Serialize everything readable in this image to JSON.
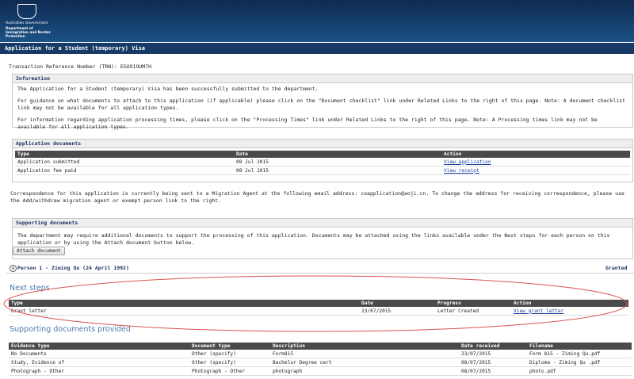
{
  "header": {
    "gov_line": "Australian Government",
    "dept_line": "Department of Immigration and Border Protection"
  },
  "title": "Application for a Student (temporary) Visa",
  "trn": "Transaction Reference Number (TRN): EGO919UM7H",
  "info": {
    "heading": "Information",
    "p1": "The Application for a Student (temporary) Visa has been successfully submitted to the department.",
    "p2": "For guidance on what documents to attach to this application (if applicable) please click on the \"Document checklist\" link under Related Links to the right of this page. Note: A document checklist link may not be available for all application types.",
    "p3": "For information regarding application processing times, please click on the \"Processing Times\" link under Related Links to the right of this page. Note: A Processing times link may not be available for all application types."
  },
  "app_docs": {
    "heading": "Application documents",
    "columns": [
      "Type",
      "Date",
      "Action"
    ],
    "rows": [
      {
        "type": "Application submitted",
        "date": "08 Jul 2015",
        "action": "View application"
      },
      {
        "type": "Application fee paid",
        "date": "08 Jul 2015",
        "action": "View receipt"
      }
    ]
  },
  "correspondence": "Correspondence for this application is currently being sent to a Migration Agent at the following email address: coapplication@aoji.cn. To change the address for receiving correspondence, please use the Add/withdraw migration agent or exempt person link to the right.",
  "supporting": {
    "heading": "Supporting documents",
    "text": "The department may require additional documents to support the processing of this application. Documents may be attached using the links available under the Next steps for each person on this application or by using the Attach document button below.",
    "attach_label": "Attach document"
  },
  "person": {
    "label": "Person 1 - Ziming Qu (24 April 1992)",
    "status": "Granted",
    "toggle_glyph": "⊖"
  },
  "next_steps": {
    "title": "Next steps",
    "columns": [
      "Type",
      "Date",
      "Progress",
      "Action"
    ],
    "rows": [
      {
        "type": "Grant letter",
        "date": "23/07/2015",
        "progress": "Letter Created",
        "action": "View grant letter"
      }
    ]
  },
  "provided": {
    "title": "Supporting documents provided",
    "columns": [
      "Evidence type",
      "Document type",
      "Description",
      "Date received",
      "Filename"
    ],
    "rows": [
      {
        "evidence": "No Documents",
        "doctype": "Other (specify)",
        "desc": "Form815",
        "date": "23/07/2015",
        "file": "Form 815 - Ziming Qu.pdf"
      },
      {
        "evidence": "Study, Evidence of",
        "doctype": "Other (specify)",
        "desc": "Bachelor Degree cert",
        "date": "08/07/2015",
        "file": "Diploma - Ziming Qu .pdf"
      },
      {
        "evidence": "Photograph - Other",
        "doctype": "Photograph - Other",
        "desc": "photograph",
        "date": "08/07/2015",
        "file": "photo.pdf"
      }
    ]
  },
  "colors": {
    "header_top": "#102a52",
    "header_bottom": "#1c5285",
    "titlebar": "#173a66",
    "table_header": "#4a4a4a",
    "section_title": "#4c78a8",
    "link": "#1a3fa0",
    "annotation": "#d9534f"
  }
}
